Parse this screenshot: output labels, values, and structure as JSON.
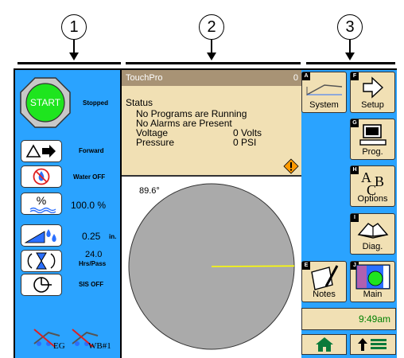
{
  "callouts": [
    "1",
    "2",
    "3"
  ],
  "left_controls": {
    "start_label": "START",
    "start_status": "Stopped",
    "direction": "Forward",
    "water": "Water OFF",
    "percent_symbol": "%",
    "percent_value": "100.0 %",
    "depth_value": "0.25",
    "depth_unit": "in.",
    "hrs_value": "24.0",
    "hrs_unit": "Hrs/Pass",
    "sis": "SIS OFF",
    "eg_label": "EG",
    "wb_label": "WB#1"
  },
  "titlebar": {
    "app": "TouchPro",
    "counter": "0"
  },
  "status": {
    "heading": "Status",
    "line1": "No Programs are Running",
    "line2": "No Alarms are Present",
    "voltage_label": "Voltage",
    "voltage_value": "0 Volts",
    "pressure_label": "Pressure",
    "pressure_value": "0 PSI"
  },
  "pivot": {
    "angle_text": "89.6°",
    "angle_deg": 89.6
  },
  "right_menu": {
    "system": {
      "key": "A",
      "label": "System"
    },
    "setup": {
      "key": "F",
      "label": "Setup"
    },
    "prog": {
      "key": "G",
      "label": "Prog."
    },
    "options": {
      "key": "H",
      "label": "Options",
      "icon_a": "A",
      "icon_b": "B",
      "icon_c": "C"
    },
    "diag": {
      "key": "I",
      "label": "Diag."
    },
    "notes": {
      "key": "E",
      "label": "Notes"
    },
    "main": {
      "key": "J",
      "label": "Main"
    },
    "time": "9:49am"
  },
  "colors": {
    "panel_blue": "#2aa3ff",
    "status_tan": "#f1e0b4",
    "titlebar": "#a89375",
    "start_green": "#1ee51e",
    "pivot_gray": "#aaaaaa",
    "alarm_orange": "#ff9a00"
  }
}
